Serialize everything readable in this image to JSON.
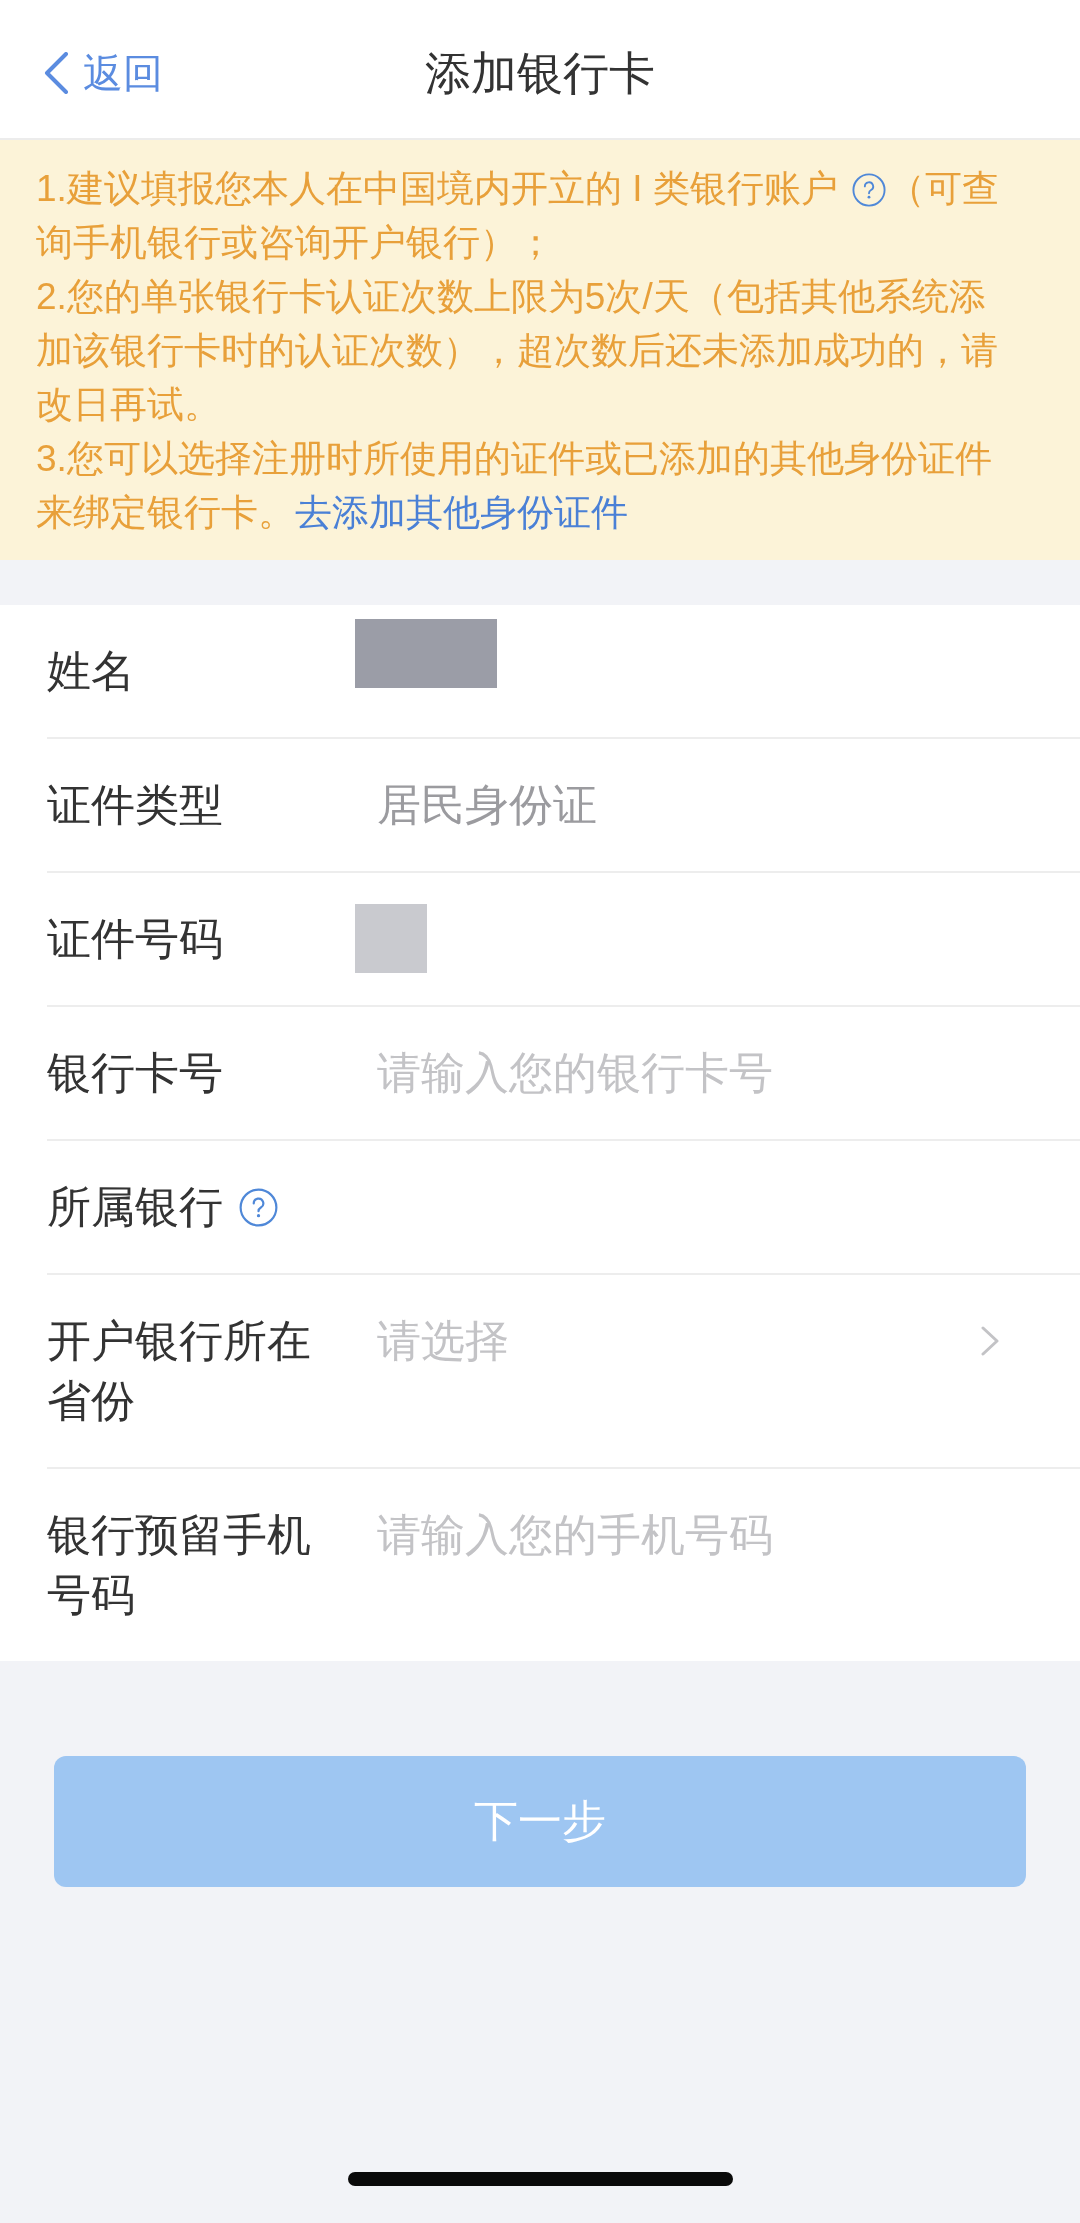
{
  "nav": {
    "back": "返回",
    "title": "添加银行卡"
  },
  "notice": {
    "items": [
      {
        "parts": [
          {
            "kind": "text",
            "text": "1.建议填报您本人在中国境内开立的 I 类银行账户 "
          },
          {
            "kind": "help"
          },
          {
            "kind": "text",
            "text": "（可查询手机银行或咨询开户银行）；"
          }
        ]
      },
      {
        "parts": [
          {
            "kind": "text",
            "text": "2.您的单张银行卡认证次数上限为5次/天（包括其他系统添加该银行卡时的认证次数），超次数后还未添加成功的，请改日再试。"
          }
        ]
      },
      {
        "parts": [
          {
            "kind": "text",
            "text": "3.您可以选择注册时所使用的证件或已添加的其他身份证件来绑定银行卡。"
          },
          {
            "kind": "link",
            "text": "去添加其他身份证件"
          }
        ]
      }
    ]
  },
  "form": {
    "rows": [
      {
        "label": "姓名",
        "kind": "masked",
        "help": false
      },
      {
        "label": "证件类型",
        "kind": "text",
        "value": "居民身份证",
        "help": false
      },
      {
        "label": "证件号码",
        "kind": "masked",
        "help": false
      },
      {
        "label": "银行卡号",
        "kind": "input",
        "placeholder": "请输入您的银行卡号",
        "help": false
      },
      {
        "label": "所属银行",
        "kind": "empty",
        "help": true
      },
      {
        "label": "开户银行所在省份",
        "kind": "select",
        "placeholder": "请选择",
        "help": false
      },
      {
        "label": "银行预留手机号码",
        "kind": "input",
        "placeholder": "请输入您的手机号码",
        "help": false
      }
    ]
  },
  "next_button": {
    "label": "下一步",
    "disabled": true
  }
}
